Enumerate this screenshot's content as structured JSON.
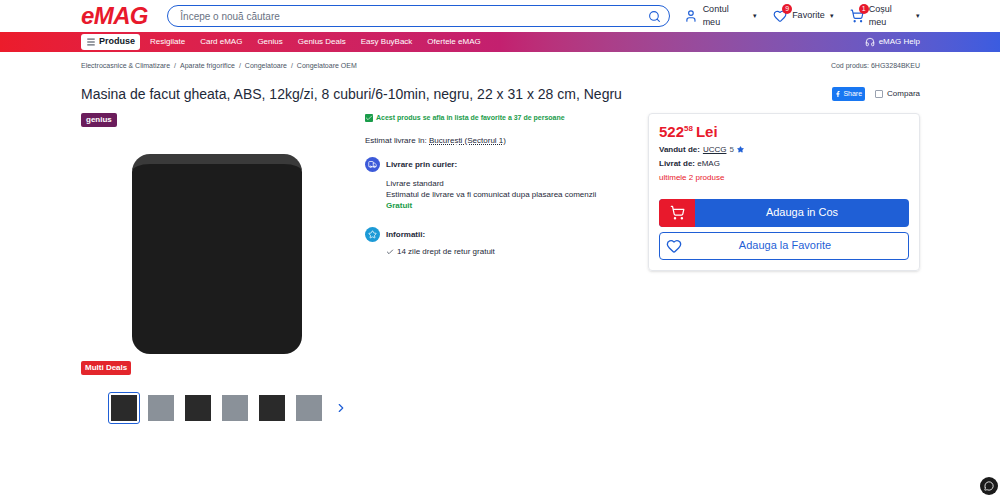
{
  "header": {
    "logo": "eMAG",
    "search": {
      "placeholder": "Începe o nouă căutare"
    },
    "account": "Contul meu",
    "favorites": {
      "label": "Favorite",
      "count": "9"
    },
    "cart": {
      "label": "Coșul meu",
      "count": "1"
    }
  },
  "nav": {
    "products": "Produse",
    "links": [
      "Resigilate",
      "Card eMAG",
      "Genius",
      "Genius Deals",
      "Easy BuyBack",
      "Ofertele eMAG"
    ],
    "help": "eMAG Help"
  },
  "breadcrumbs": {
    "separator": "/",
    "items": [
      "Electrocasnice & Climatizare",
      "Aparate frigorifice",
      "Congelatoare",
      "Congelatoare OEM"
    ]
  },
  "product_code": "Cod produs: 6HG3284BKEU",
  "title": "Masina de facut gheata, ABS, 12kg/zi, 8 cuburi/6-10min, negru, 22 x 31 x 28 cm, Negru",
  "share": "Share",
  "compare": {
    "label": "Compara",
    "checked": false
  },
  "badges": {
    "genius": "genius",
    "deal": "Multi Deals"
  },
  "thumbnails": [
    {
      "selected": true
    },
    {
      "selected": false
    },
    {
      "selected": false
    },
    {
      "selected": false
    },
    {
      "selected": false
    },
    {
      "selected": false
    }
  ],
  "favorites_note": "Acest produs se afla in lista de favorite a 37 de persoane",
  "delivery": {
    "estimate_label": "Estimat livrare în:",
    "location": "București (Sectorul 1)",
    "courier_title": "Livrare prin curier:",
    "method": "Livrare standard",
    "note": "Estimatul de livrare va fi comunicat dupa plasarea comenzii",
    "price": "Gratuit"
  },
  "info": {
    "title": "Informatii:",
    "items": [
      "14 zile drept de retur gratuit"
    ]
  },
  "offer": {
    "price_int": "522",
    "price_dec": "58",
    "currency": "Lei",
    "seller_label": "Vandut de:",
    "seller": "UCCG",
    "seller_rating": "5",
    "delivered_label": "Livrat de:",
    "delivered_by": "eMAG",
    "stock": "ultimele 2 produse",
    "add_to_cart": "Adauga in Cos",
    "add_to_favorites": "Adauga la Favorite"
  }
}
